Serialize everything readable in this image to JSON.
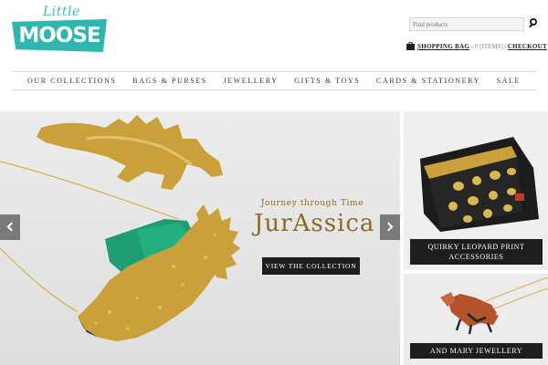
{
  "header": {
    "logo_small": "Little",
    "logo_main": "MOOSE",
    "search_placeholder": "Find products",
    "bag_label": "SHOPPING BAG",
    "bag_count": "- 0 [ITEMS]",
    "checkout_label": "CHECKOUT"
  },
  "nav": {
    "items": [
      {
        "label": "OUR COLLECTIONS"
      },
      {
        "label": "BAGS & PURSES"
      },
      {
        "label": "JEWELLERY"
      },
      {
        "label": "GIFTS & TOYS"
      },
      {
        "label": "CARDS & STATIONERY"
      },
      {
        "label": "SALE"
      }
    ]
  },
  "hero": {
    "subtitle": "Journey through Time",
    "title": "JurAssica",
    "cta_label": "VIEW THE COLLECTION"
  },
  "promos": [
    {
      "label": "QUIRKY LEOPARD PRINT ACCESSORIES"
    },
    {
      "label": "AND MARY JEWELLERY"
    }
  ],
  "colors": {
    "brand_teal": "#2fb6ae",
    "dark_button": "#1e1e1e",
    "gold": "#c9a03a",
    "emerald": "#1f9e74",
    "hero_text": "#8a6a2a"
  }
}
